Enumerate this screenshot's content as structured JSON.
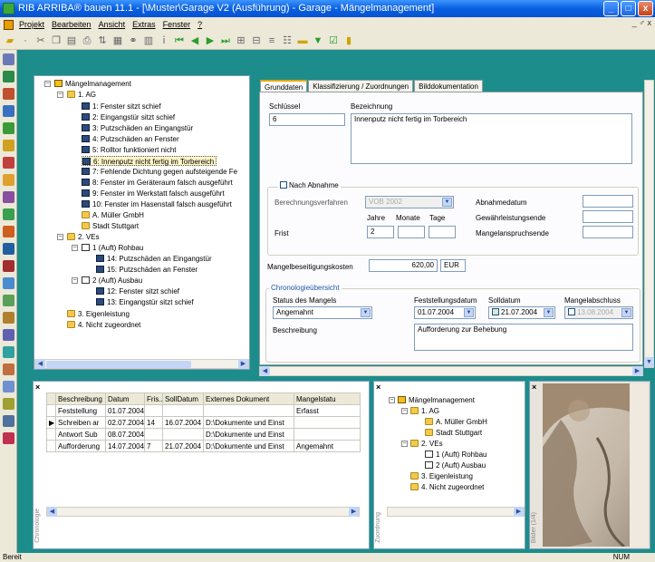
{
  "window": {
    "title": "RIB ARRIBA® bauen 11.1 - [\\Muster\\Garage V2 (Ausführung) - Garage - Mängelmanagement]",
    "buttons": [
      "_",
      "□",
      "x"
    ]
  },
  "menu": {
    "items": [
      "Projekt",
      "Bearbeiten",
      "Ansicht",
      "Extras",
      "Fenster",
      "?"
    ],
    "mdi_controls": "_ ♂ x"
  },
  "tree": {
    "root": "Mängelmanagement",
    "group1": "1. AG",
    "items": [
      "1: Fenster sitzt schief",
      "2: Eingangstür sitzt schief",
      "3: Putzschäden an Eingangstür",
      "4: Putzschäden an Fenster",
      "5: Rolltor funktioniert nicht",
      "6: Innenputz nicht fertig im Torbereich",
      "7: Fehlende Dichtung gegen aufsteigende Fe",
      "8: Fenster im Geräteraum falsch ausgeführt",
      "9: Fenster im Werkstatt falsch ausgeführt",
      "10: Fenster im Hasenstall falsch ausgeführt"
    ],
    "company": "A. Müller GmbH",
    "city": "Stadt Stuttgart",
    "group2": "2. VEs",
    "sub1": "1 (Auft) Rohbau",
    "sub1_items": [
      "14: Putzschäden an Eingangstür",
      "15: Putzschäden an Fenster"
    ],
    "sub2": "2 (Auft) Ausbau",
    "sub2_items": [
      "12: Fenster sitzt schief",
      "13: Eingangstür sitzt schief"
    ],
    "group3": "3. Eigenleistung",
    "group4": "4. Nicht zugeordnet"
  },
  "tabs": [
    "Grunddaten",
    "Klassifizierung / Zuordnungen",
    "Bilddokumentation"
  ],
  "form": {
    "schluessel_label": "Schlüssel",
    "schluessel_value": "6",
    "bezeichnung_label": "Bezeichnung",
    "bezeichnung_value": "Innenputz nicht fertig im Torbereich",
    "nach_abnahme": "Nach Abnahme",
    "verfahren_label": "Berechnungsverfahren",
    "verfahren_value": "VOB 2002",
    "jahre": "Jahre",
    "monate": "Monate",
    "tage": "Tage",
    "frist_label": "Frist",
    "frist_value": "2",
    "abnahmedatum": "Abnahmedatum",
    "gewaehrleistungsende": "Gewährleistungsende",
    "mangelanspruchsende": "Mangelanspruchsende",
    "kosten_label": "Mangelbeseitigungskosten",
    "kosten_value": "620,00",
    "currency": "EUR",
    "chronologie_title": "Chronologieübersicht",
    "status_label": "Status des Mangels",
    "status_value": "Angemahnt",
    "feststellung_label": "Feststellungsdatum",
    "feststellung_value": "01.07.2004",
    "solldatum_label": "Solldatum",
    "solldatum_value": "21.07.2004",
    "abschluss_label": "Mangelabschluss",
    "abschluss_value": "13.08.2004",
    "beschreibung_label": "Beschreibung",
    "beschreibung_value": "Aufforderung zur Behebung"
  },
  "chronologie": {
    "side_label": "Chronologie",
    "headers": [
      "Beschreibung",
      "Datum",
      "Fris...",
      "SollDatum",
      "Externes Dokument",
      "Mangelstatu"
    ],
    "rows": [
      [
        "Feststellung",
        "01.07.2004",
        "",
        "",
        "",
        "Erfasst"
      ],
      [
        "Schreiben ar",
        "02.07.2004",
        "14",
        "16.07.2004",
        "D:\\Dokumente und Einst",
        ""
      ],
      [
        "Antwort Sub",
        "08.07.2004",
        "",
        "",
        "D:\\Dokumente und Einst",
        ""
      ],
      [
        "Aufforderung",
        "14.07.2004",
        "7",
        "21.07.2004",
        "D:\\Dokumente und Einst",
        "Angemahnt"
      ]
    ]
  },
  "tree2": {
    "side_label": "Zuordnung",
    "root": "Mängelmanagement",
    "group1": "1. AG",
    "company": "A. Müller GmbH",
    "city": "Stadt Stuttgart",
    "group2": "2. VEs",
    "sub1": "1 (Auft) Rohbau",
    "sub2": "2 (Auft) Ausbau",
    "group3": "3. Eigenleistung",
    "group4": "4. Nicht zugeordnet"
  },
  "photo": {
    "side_label": "Bilder (1/4)"
  },
  "status": {
    "left": "Bereit",
    "right": "NUM"
  },
  "colors": {
    "titlebar": "#0a5fe0",
    "chrome": "#ece9d8",
    "selection": "#fff6c8",
    "accent_tab": "#e8a400"
  }
}
